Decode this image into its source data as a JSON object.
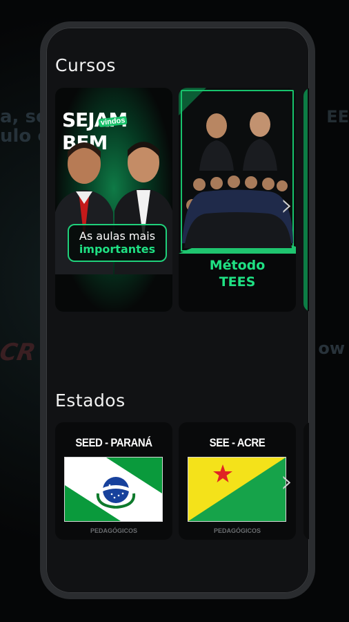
{
  "sections": {
    "courses_title": "Cursos",
    "states_title": "Estados"
  },
  "courses": [
    {
      "headline": "SEJAM BEM",
      "tag": "vindos",
      "pill_line1": "As aulas mais",
      "pill_line2": "importantes"
    },
    {
      "title_line1": "Método",
      "title_line2": "TEES"
    }
  ],
  "states": [
    {
      "title": "SEED - PARANÁ",
      "logo": "PEDAGÓGICOS"
    },
    {
      "title": "SEE - ACRE",
      "logo": "PEDAGÓGICOS"
    }
  ],
  "icons": {
    "next": "chevron-right-icon"
  },
  "colors": {
    "accent": "#1fe083",
    "card_bg": "#070809",
    "phone_bg": "#111214"
  }
}
